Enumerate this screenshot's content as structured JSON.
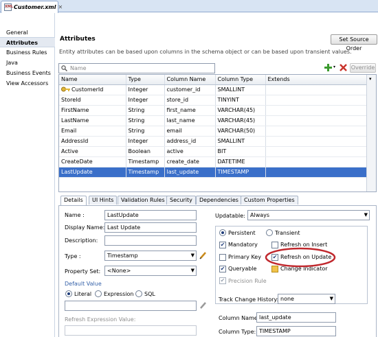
{
  "doc_tab": {
    "title": "Customer.xml",
    "icon": "xml-file-icon"
  },
  "nav": {
    "items": [
      "General",
      "Attributes",
      "Business Rules",
      "Java",
      "Business Events",
      "View Accessors"
    ],
    "selected": "Attributes"
  },
  "header": {
    "title": "Attributes",
    "set_source_order": "Set Source Order",
    "description": "Entity attributes can be based upon columns in the schema object or can be based upon transient values."
  },
  "search": {
    "placeholder": "Name"
  },
  "toolbar": {
    "override_label": "Override"
  },
  "table": {
    "columns": [
      "Name",
      "Type",
      "Column Name",
      "Column Type",
      "Extends"
    ],
    "rows": [
      [
        "CustomerId",
        "Integer",
        "customer_id",
        "SMALLINT",
        ""
      ],
      [
        "StoreId",
        "Integer",
        "store_id",
        "TINYINT",
        ""
      ],
      [
        "FirstName",
        "String",
        "first_name",
        "VARCHAR(45)",
        ""
      ],
      [
        "LastName",
        "String",
        "last_name",
        "VARCHAR(45)",
        ""
      ],
      [
        "Email",
        "String",
        "email",
        "VARCHAR(50)",
        ""
      ],
      [
        "AddressId",
        "Integer",
        "address_id",
        "SMALLINT",
        ""
      ],
      [
        "Active",
        "Boolean",
        "active",
        "BIT",
        ""
      ],
      [
        "CreateDate",
        "Timestamp",
        "create_date",
        "DATETIME",
        ""
      ],
      [
        "LastUpdate",
        "Timestamp",
        "last_update",
        "TIMESTAMP",
        ""
      ]
    ],
    "selected_row": "LastUpdate",
    "key_icon_row": "CustomerId"
  },
  "subtabs": [
    "Details",
    "UI Hints",
    "Validation Rules",
    "Security",
    "Dependencies",
    "Custom Properties"
  ],
  "details": {
    "name_label": "Name :",
    "name_value": "LastUpdate",
    "display_name_label": "Display Name:",
    "display_name_value": "Last Update",
    "description_label": "Description:",
    "description_value": "",
    "type_label": "Type :",
    "type_value": "Timestamp",
    "property_set_label": "Property Set:",
    "property_set_value": "<None>",
    "default_value_label": "Default Value",
    "literal": "Literal",
    "expression": "Expression",
    "sql": "SQL",
    "refresh_expression_label": "Refresh Expression Value:",
    "updatable_label": "Updatable:",
    "updatable_value": "Always",
    "persistent": "Persistent",
    "transient": "Transient",
    "mandatory": "Mandatory",
    "refresh_on_insert": "Refresh on Insert",
    "primary_key": "Primary Key",
    "refresh_on_update": "Refresh on Update",
    "queryable": "Queryable",
    "change_indicator": "Change Indicator",
    "precision_rule": "Precision Rule",
    "track_change_label": "Track Change History:",
    "track_change_value": "none",
    "column_name_label": "Column Name:",
    "column_name_value": "last_update",
    "column_type_label": "Column Type:",
    "column_type_value": "TIMESTAMP"
  },
  "colors": {
    "selection": "#3a6fc9",
    "highlight_ellipse": "#c0282d",
    "link": "#3461a8"
  }
}
